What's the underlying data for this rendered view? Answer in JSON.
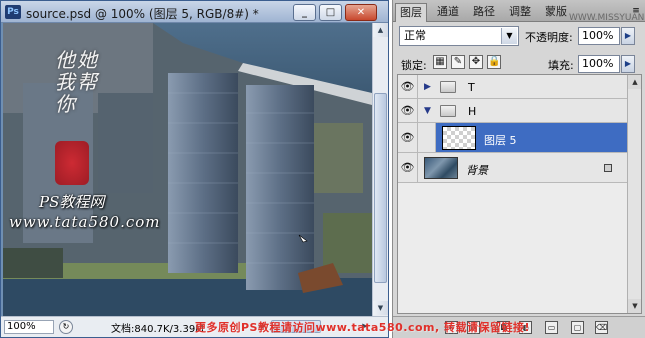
{
  "document": {
    "ps_badge": "Ps",
    "title": "source.psd @ 100% (图层 5, RGB/8#) *",
    "zoom": "100%",
    "doc_info": "文档:840.7K/3.39M",
    "controls": {
      "minimize": "_",
      "restore": "□",
      "close": "✕"
    },
    "scroll_arrows": {
      "up": "▲",
      "down": "▼",
      "left": "◀",
      "right": "▶"
    },
    "status_icon": "↻"
  },
  "watermark": {
    "calligraphy": "他她我帮你",
    "line1": "PS教程网",
    "line2": "www.tata580.com",
    "seal_color": "#c41a22"
  },
  "layers_panel": {
    "tabs": [
      "图层",
      "通道",
      "路径",
      "调整",
      "蒙版"
    ],
    "menu_icon": "≡",
    "site_watermark": "WWW.MISSYUAN.COM",
    "blend_mode": "正常",
    "blend_chevron": "▼",
    "opacity_label": "不透明度:",
    "opacity_value": "100%",
    "lock_label": "锁定:",
    "fill_label": "填充:",
    "fill_value": "100%",
    "arrow_glyph": "▶",
    "eye_glyph": "👁",
    "layers": [
      {
        "name": "T",
        "type": "group",
        "expanded": false,
        "visible": true,
        "disclosure": "▶"
      },
      {
        "name": "H",
        "type": "group",
        "expanded": true,
        "visible": true,
        "disclosure": "▼"
      },
      {
        "name": "图层 5",
        "type": "layer",
        "selected": true,
        "visible": true
      },
      {
        "name": "背景",
        "type": "background",
        "locked": true,
        "visible": true
      }
    ],
    "footer_icons": [
      "link-icon",
      "fx-icon",
      "mask-icon",
      "adjustment-icon",
      "folder-icon",
      "new-layer-icon",
      "trash-icon"
    ]
  },
  "banner": "更多原创PS教程请访问www.tata580.com, 转载请保留链接!",
  "colors": {
    "selection": "#3e6cc2",
    "accent_blue": "#1d3f87"
  }
}
